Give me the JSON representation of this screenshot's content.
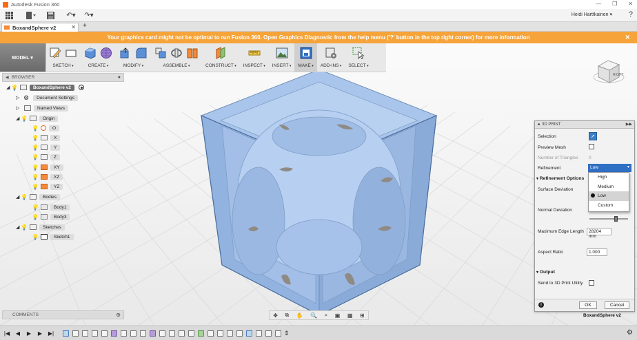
{
  "window": {
    "title": "Autodesk Fusion 360",
    "controls": [
      "—",
      "❐",
      "✕"
    ]
  },
  "quick_access": {
    "user": "Heidi Harttkainen ▾",
    "help_label": "?"
  },
  "tab": {
    "title": "BoxandSphere v2",
    "close": "✕",
    "new": "+"
  },
  "warning": {
    "text": "Your graphics card might not be optimal to run Fusion 360. Open Graphics Diagnostic from the help menu ('?' button in the top right corner) for more information",
    "close": "✕"
  },
  "toolbar": {
    "mode": "MODEL ▾",
    "groups": [
      {
        "label": "SKETCH",
        "icons": [
          "sketch-pencil-icon",
          "rectangle-icon"
        ]
      },
      {
        "label": "CREATE",
        "icons": [
          "box-icon",
          "grid-sphere-icon"
        ]
      },
      {
        "label": "MODIFY",
        "icons": [
          "press-pull-icon",
          "fillet-icon"
        ]
      },
      {
        "label": "ASSEMBLE",
        "icons": [
          "new-component-icon",
          "joint-icon",
          "joint-origin-icon"
        ]
      },
      {
        "label": "CONSTRUCT",
        "icons": [
          "offset-plane-icon"
        ]
      },
      {
        "label": "INSPECT",
        "icons": [
          "measure-icon"
        ]
      },
      {
        "label": "INSERT",
        "icons": [
          "insert-image-icon"
        ]
      },
      {
        "label": "MAKE",
        "icons": [
          "3d-print-icon"
        ]
      },
      {
        "label": "ADD-INS",
        "icons": [
          "scripts-icon"
        ]
      },
      {
        "label": "SELECT",
        "icons": [
          "select-arrow-icon"
        ]
      }
    ]
  },
  "browser": {
    "header": "BROWSER",
    "root": "BoxandSphere v2",
    "items": [
      {
        "label": "Document Settings",
        "type": "gear"
      },
      {
        "label": "Named Views",
        "type": "folder"
      },
      {
        "label": "Origin",
        "type": "folder"
      },
      {
        "label": "O",
        "type": "origin"
      },
      {
        "label": "X",
        "type": "axis"
      },
      {
        "label": "Y",
        "type": "axis"
      },
      {
        "label": "Z",
        "type": "axis"
      },
      {
        "label": "XY",
        "type": "plane"
      },
      {
        "label": "XZ",
        "type": "plane"
      },
      {
        "label": "YZ",
        "type": "plane"
      },
      {
        "label": "Bodies",
        "type": "folder"
      },
      {
        "label": "Body1",
        "type": "body"
      },
      {
        "label": "Body3",
        "type": "body"
      },
      {
        "label": "Sketches",
        "type": "folder"
      },
      {
        "label": "Sketch1",
        "type": "sketch"
      }
    ]
  },
  "comments": {
    "label": "COMMENTS"
  },
  "navbar": {
    "icons": [
      "orbit-icon",
      "pan-icon",
      "hand-icon",
      "zoom-icon",
      "zoom-window-icon",
      "display-settings-icon",
      "grid-icon",
      "viewports-icon"
    ]
  },
  "viewcube": {
    "label": "RIGHT"
  },
  "dialog": {
    "title": "3D PRINT",
    "selection_label": "Selection",
    "preview_mesh_label": "Preview Mesh",
    "num_triangles_label": "Number of Triangles",
    "num_triangles_value": "0",
    "refinement_label": "Refinement",
    "refinement_value": "Low",
    "refinement_options": [
      "High",
      "Medium",
      "Low",
      "Custom"
    ],
    "refinement_options_header": "Refinement Options",
    "surface_deviation_label": "Surface Deviation",
    "normal_deviation_label": "Normal Deviation",
    "normal_deviation_slider": 0.7,
    "max_edge_label": "Maximum Edge Length",
    "max_edge_value": "28204 mm",
    "aspect_ratio_label": "Aspect Ratio",
    "aspect_ratio_value": "1.000",
    "output_header": "Output",
    "send_label": "Send to 3D Print Utility",
    "ok": "OK",
    "cancel": "Cancel",
    "info": "i"
  },
  "document_name": "BoxandSphere v2",
  "timeline": {
    "controls": [
      "|◀",
      "◀",
      "▶",
      "▶",
      "▶|"
    ],
    "gear": "⚙"
  },
  "colors": {
    "warning": "#f6a43a",
    "selection": "#2f6fc4",
    "model_fill": "#9dbbe6"
  }
}
